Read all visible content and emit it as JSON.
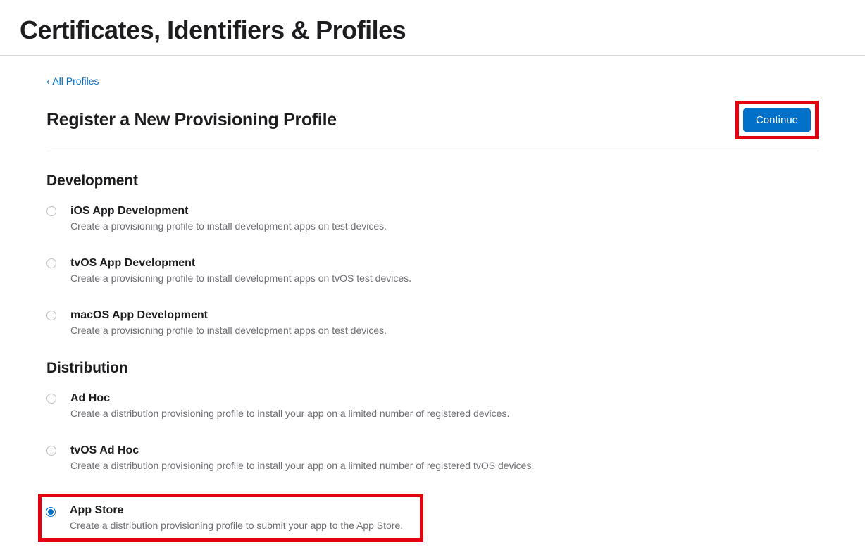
{
  "page_title": "Certificates, Identifiers & Profiles",
  "back_link": "All Profiles",
  "header": "Register a New Provisioning Profile",
  "continue_label": "Continue",
  "sections": {
    "development": {
      "heading": "Development",
      "options": [
        {
          "title": "iOS App Development",
          "desc": "Create a provisioning profile to install development apps on test devices.",
          "selected": false
        },
        {
          "title": "tvOS App Development",
          "desc": "Create a provisioning profile to install development apps on tvOS test devices.",
          "selected": false
        },
        {
          "title": "macOS App Development",
          "desc": "Create a provisioning profile to install development apps on test devices.",
          "selected": false
        }
      ]
    },
    "distribution": {
      "heading": "Distribution",
      "options": [
        {
          "title": "Ad Hoc",
          "desc": "Create a distribution provisioning profile to install your app on a limited number of registered devices.",
          "selected": false
        },
        {
          "title": "tvOS Ad Hoc",
          "desc": "Create a distribution provisioning profile to install your app on a limited number of registered tvOS devices.",
          "selected": false
        },
        {
          "title": "App Store",
          "desc": "Create a distribution provisioning profile to submit your app to the App Store.",
          "selected": true
        }
      ]
    }
  }
}
